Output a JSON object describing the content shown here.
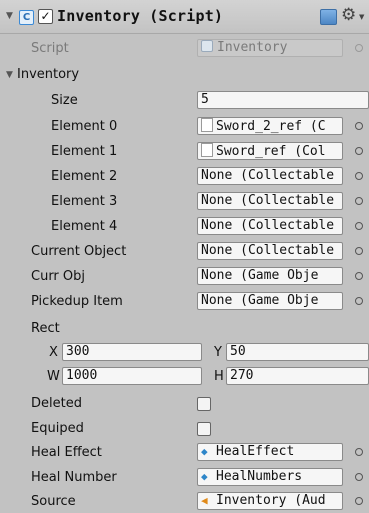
{
  "header": {
    "title": "Inventory (Script)",
    "enabled": true,
    "icons": {
      "fold": "triangle-down",
      "component": "script-component-icon",
      "help": "book-icon",
      "settings": "gear-icon"
    }
  },
  "script_row": {
    "label": "Script",
    "value": "Inventory"
  },
  "inventory_section": {
    "label": "Inventory",
    "size_label": "Size",
    "size_value": "5",
    "elements": [
      {
        "label": "Element 0",
        "value": "Sword_2_ref (C"
      },
      {
        "label": "Element 1",
        "value": "Sword_ref (Col"
      },
      {
        "label": "Element 2",
        "value": "None (Collectable"
      },
      {
        "label": "Element 3",
        "value": "None (Collectable"
      },
      {
        "label": "Element 4",
        "value": "None (Collectable"
      }
    ]
  },
  "fields": {
    "current_object": {
      "label": "Current Object",
      "value": "None (Collectable"
    },
    "curr_obj": {
      "label": "Curr Obj",
      "value": "None (Game Obje"
    },
    "pickedup_item": {
      "label": "Pickedup Item",
      "value": "None (Game Obje"
    }
  },
  "rect": {
    "label": "Rect",
    "x_label": "X",
    "x_value": "300",
    "y_label": "Y",
    "y_value": "50",
    "w_label": "W",
    "w_value": "1000",
    "h_label": "H",
    "h_value": "270"
  },
  "toggles": {
    "deleted": {
      "label": "Deleted",
      "checked": false
    },
    "equiped": {
      "label": "Equiped",
      "checked": false
    }
  },
  "refs": {
    "heal_effect": {
      "label": "Heal Effect",
      "value": "HealEffect"
    },
    "heal_number": {
      "label": "Heal Number",
      "value": "HealNumbers"
    },
    "source": {
      "label": "Source",
      "value": "Inventory (Aud"
    }
  },
  "colors": {
    "panel": "#c2c2c2",
    "field": "#f6f6f6",
    "accent": "#2e86c9",
    "audio": "#e08a1a"
  }
}
